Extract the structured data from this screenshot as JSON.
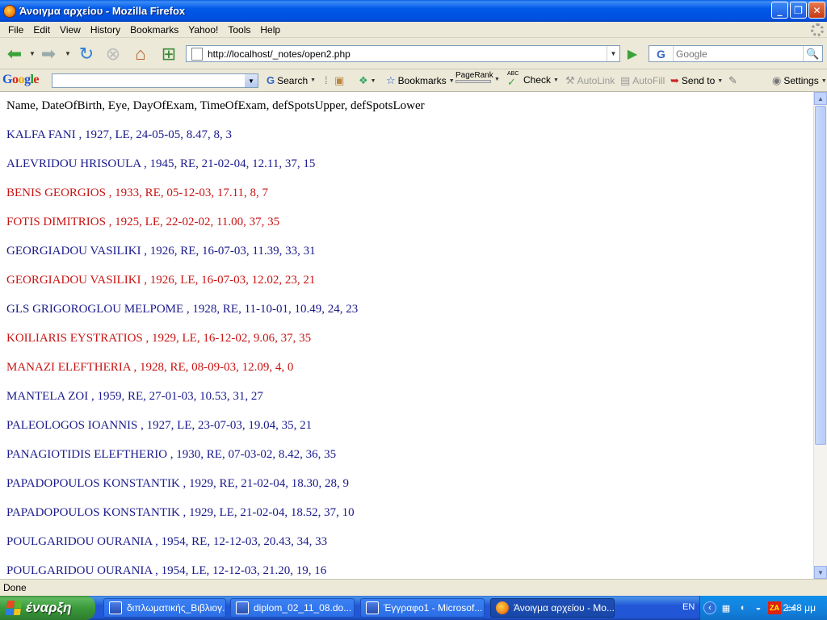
{
  "window": {
    "title": "Άνοιγμα αρχείου - Mozilla Firefox"
  },
  "menu": [
    "File",
    "Edit",
    "View",
    "History",
    "Bookmarks",
    "Yahoo!",
    "Tools",
    "Help"
  ],
  "nav": {
    "url": "http://localhost/_notes/open2.php",
    "search_placeholder": "Google",
    "search_engine_letter": "G"
  },
  "google_toolbar": {
    "logo": [
      "G",
      "o",
      "o",
      "g",
      "l",
      "e"
    ],
    "search_label": "Search",
    "bookmarks_label": "Bookmarks",
    "pagerank_label": "PageRank",
    "check_label": "Check",
    "check_abc": "ABC",
    "autolink_label": "AutoLink",
    "autofill_label": "AutoFill",
    "sendto_label": "Send to",
    "settings_label": "Settings"
  },
  "content": {
    "header": "Name, DateOfBirth, Eye, DayOfExam, TimeOfExam, defSpotsUpper, defSpotsLower",
    "rows": [
      {
        "text": "KALFA FANI , 1927, LE, 24-05-05, 8.47, 8, 3",
        "color": "blue"
      },
      {
        "text": "ALEVRIDOU HRISOULA , 1945, RE, 21-02-04, 12.11, 37, 15",
        "color": "blue"
      },
      {
        "text": "BENIS GEORGIOS , 1933, RE, 05-12-03, 17.11, 8, 7",
        "color": "red"
      },
      {
        "text": "FOTIS DIMITRIOS , 1925, LE, 22-02-02, 11.00, 37, 35",
        "color": "red"
      },
      {
        "text": "GEORGIADOU VASILIKI , 1926, RE, 16-07-03, 11.39, 33, 31",
        "color": "blue"
      },
      {
        "text": "GEORGIADOU VASILIKI , 1926, LE, 16-07-03, 12.02, 23, 21",
        "color": "red"
      },
      {
        "text": "GLS GRIGOROGLOU MELPOME , 1928, RE, 11-10-01, 10.49, 24, 23",
        "color": "blue"
      },
      {
        "text": "KOILIARIS EYSTRATIOS , 1929, LE, 16-12-02, 9.06, 37, 35",
        "color": "red"
      },
      {
        "text": "MANAZI ELEFTHERIA , 1928, RE, 08-09-03, 12.09, 4, 0",
        "color": "red"
      },
      {
        "text": "MANTELA ZOI , 1959, RE, 27-01-03, 10.53, 31, 27",
        "color": "blue"
      },
      {
        "text": "PALEOLOGOS IOANNIS , 1927, LE, 23-07-03, 19.04, 35, 21",
        "color": "blue"
      },
      {
        "text": "PANAGIOTIDIS ELEFTHERIO , 1930, RE, 07-03-02, 8.42, 36, 35",
        "color": "blue"
      },
      {
        "text": "PAPADOPOULOS KONSTANTIK , 1929, RE, 21-02-04, 18.30, 28, 9",
        "color": "blue"
      },
      {
        "text": "PAPADOPOULOS KONSTANTIK , 1929, LE, 21-02-04, 18.52, 37, 10",
        "color": "blue"
      },
      {
        "text": "POULGARIDOU OURANIA , 1954, RE, 12-12-03, 20.43, 34, 33",
        "color": "blue"
      },
      {
        "text": "POULGARIDOU OURANIA , 1954, LE, 12-12-03, 21.20, 19, 16",
        "color": "blue"
      }
    ]
  },
  "status": "Done",
  "taskbar": {
    "start_label": "έναρξη",
    "tasks": [
      {
        "label": "διπλωματικής_Βιβλιογ...",
        "icon": "word",
        "active": false
      },
      {
        "label": "diplom_02_11_08.do...",
        "icon": "word",
        "active": false
      },
      {
        "label": "Έγγραφο1 - Microsof...",
        "icon": "word",
        "active": false
      },
      {
        "label": "Άνοιγμα αρχείου - Mo...",
        "icon": "firefox",
        "active": true
      }
    ],
    "lang": "EN",
    "clock": "2:48 μμ"
  },
  "colors": {
    "row_blue": "#1a1a8c",
    "row_red": "#c81414"
  }
}
